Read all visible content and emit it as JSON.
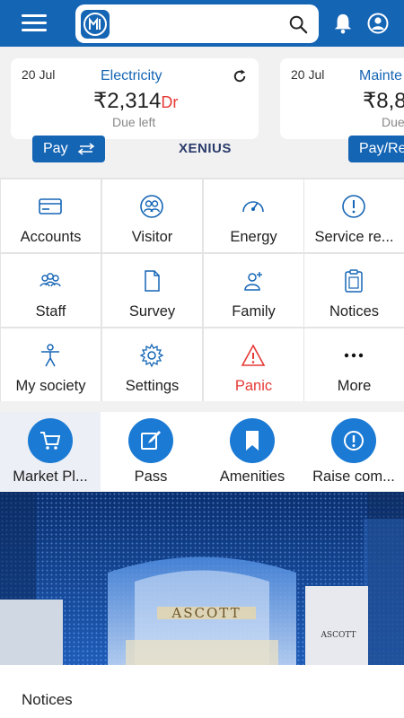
{
  "header": {
    "menu_icon": "hamburger-icon",
    "logo_icon": "society-logo",
    "search_icon": "search-icon",
    "notification_icon": "bell-icon",
    "profile_icon": "profile-icon",
    "color": "#1565b5"
  },
  "bills": [
    {
      "date": "20 Jul",
      "type": "Electricity",
      "amount": "₹2,314",
      "balance_flag": "Dr",
      "status": "Due left",
      "action": "Pay",
      "provider": "XENIUS"
    },
    {
      "date": "20 Jul",
      "type": "Mainte",
      "amount": "₹8,8",
      "status": "Due",
      "action": "Pay/Re"
    }
  ],
  "services": [
    {
      "label": "Accounts",
      "icon": "card-icon"
    },
    {
      "label": "Visitor",
      "icon": "visitor-icon"
    },
    {
      "label": "Energy",
      "icon": "gauge-icon"
    },
    {
      "label": "Service re...",
      "icon": "info-icon"
    },
    {
      "label": "Staff",
      "icon": "staff-icon"
    },
    {
      "label": "Survey",
      "icon": "document-icon"
    },
    {
      "label": "Family",
      "icon": "family-icon"
    },
    {
      "label": "Notices",
      "icon": "clipboard-icon"
    },
    {
      "label": "My society",
      "icon": "person-icon"
    },
    {
      "label": "Settings",
      "icon": "gear-icon"
    },
    {
      "label": "Panic",
      "icon": "warning-icon",
      "color": "#e53935"
    },
    {
      "label": "More",
      "icon": "more-icon"
    }
  ],
  "quick_actions": [
    {
      "label": "Market Pl...",
      "icon": "cart-icon"
    },
    {
      "label": "Pass",
      "icon": "edit-icon"
    },
    {
      "label": "Amenities",
      "icon": "bookmark-icon"
    },
    {
      "label": "Raise com...",
      "icon": "alert-icon"
    }
  ],
  "banner": {
    "sign_text": "ASCOTT",
    "side_sign": "ASCOTT"
  },
  "notices": {
    "title": "Notices"
  }
}
